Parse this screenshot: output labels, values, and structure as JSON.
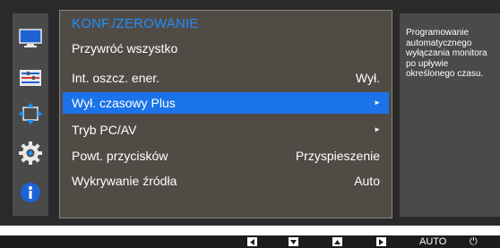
{
  "menu": {
    "title": "KONF./ZEROWANIE",
    "items": [
      {
        "label": "Przywróć wszystko",
        "value": "",
        "arrow": ""
      },
      {
        "label": "Int. oszcz. ener.",
        "value": "Wył.",
        "arrow": ""
      },
      {
        "label": "Wył. czasowy Plus",
        "value": "",
        "arrow": "►"
      },
      {
        "label": "Tryb PC/AV",
        "value": "",
        "arrow": "►"
      },
      {
        "label": "Powt. przycisków",
        "value": "Przyspieszenie",
        "arrow": ""
      },
      {
        "label": "Wykrywanie źródła",
        "value": "Auto",
        "arrow": ""
      }
    ],
    "selected_index": 2
  },
  "help": {
    "text": "Programowanie\nautomatycznego\nwyłączania monitora\npo upływie\nokreślonego czasu."
  },
  "bottom_bar": {
    "auto_label": "AUTO",
    "power_symbol": "⏻"
  },
  "sidebar": {
    "icons": [
      "monitor-icon",
      "picture-settings-icon",
      "resize-icon",
      "gear-icon",
      "info-icon"
    ]
  },
  "colors": {
    "accent": "#1a73e8",
    "title": "#1e90ff",
    "panel_bg": "#514b46"
  }
}
